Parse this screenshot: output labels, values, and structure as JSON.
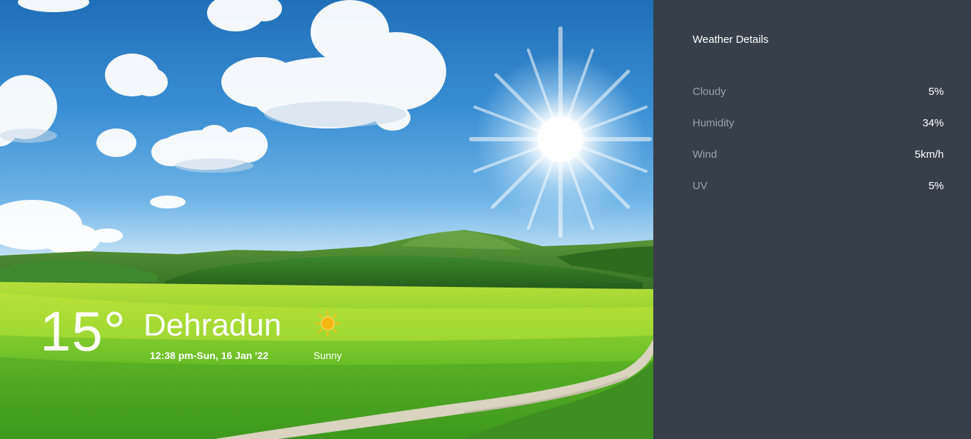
{
  "weather": {
    "temperature": "15°",
    "city": "Dehradun",
    "datetime": "12:38 pm-Sun, 16 Jan '22",
    "condition": "Sunny",
    "condition_icon": "sun-icon"
  },
  "details": {
    "title": "Weather Details",
    "items": [
      {
        "label": "Cloudy",
        "value": "5%"
      },
      {
        "label": "Humidity",
        "value": "34%"
      },
      {
        "label": "Wind",
        "value": "5km/h"
      },
      {
        "label": "UV",
        "value": "5%"
      }
    ]
  },
  "colors": {
    "panel_bg": "#373f4a",
    "label_gray": "#9aa1aa",
    "sky_blue": "#2f7fc7",
    "grass_green": "#6bc72b",
    "sun_yellow": "#f6c21a"
  }
}
